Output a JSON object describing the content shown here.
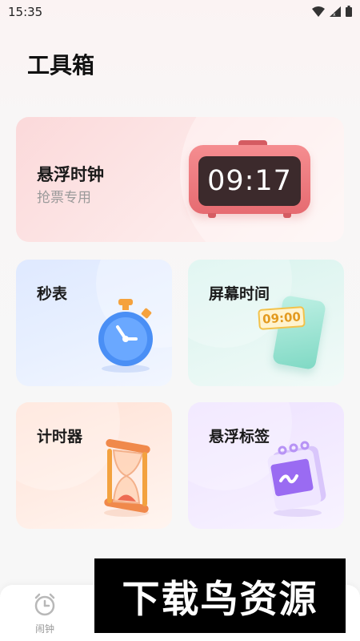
{
  "status_bar": {
    "time": "15:35",
    "icons": [
      "wifi-icon",
      "signal-icon",
      "battery-icon"
    ]
  },
  "page": {
    "title": "工具箱"
  },
  "cards": {
    "floating_clock": {
      "title": "悬浮时钟",
      "subtitle": "抢票专用",
      "display_time": "09:17",
      "icon": "alarm-clock-illustration"
    },
    "stopwatch": {
      "title": "秒表",
      "icon": "stopwatch-illustration"
    },
    "screen_time": {
      "title": "屏幕时间",
      "display_time": "09:00",
      "icon": "phone-time-illustration"
    },
    "timer": {
      "title": "计时器",
      "icon": "hourglass-illustration"
    },
    "floating_tag": {
      "title": "悬浮标签",
      "icon": "notepad-illustration"
    }
  },
  "bottom_nav": {
    "items": [
      {
        "label": "闹钟",
        "icon": "alarm-clock-icon"
      }
    ]
  },
  "watermark": {
    "text": "下载鸟资源"
  },
  "colors": {
    "clock_body": "#e66b71",
    "stopwatch_blue": "#3f8bff",
    "screen_green": "#7fd9c4",
    "timer_orange": "#f29a53",
    "tag_purple": "#9a6bf2"
  }
}
